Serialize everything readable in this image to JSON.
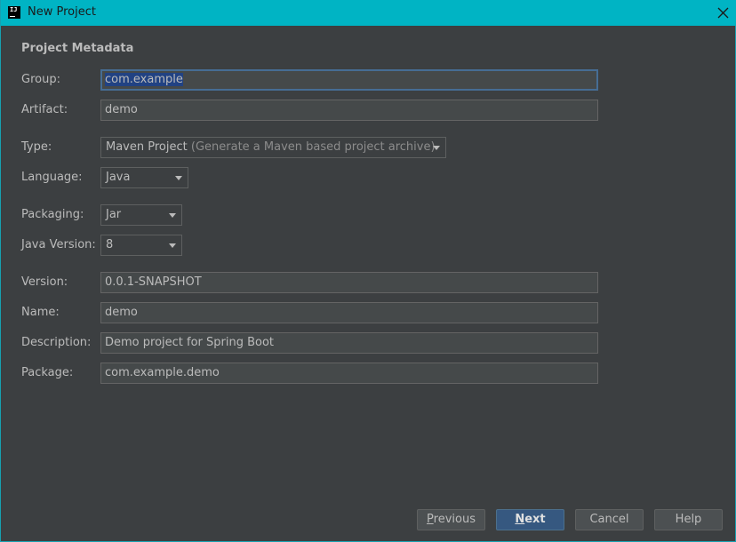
{
  "window": {
    "title": "New Project",
    "logo_text": "IJ",
    "icons": {
      "logo": "intellij-logo-icon",
      "close": "close-icon"
    }
  },
  "form": {
    "section_title": "Project Metadata",
    "group": {
      "label": "Group:",
      "value": "com.example"
    },
    "artifact": {
      "label": "Artifact:",
      "value": "demo"
    },
    "type": {
      "label": "Type:",
      "value": "Maven Project",
      "hint": "(Generate a Maven based project archive)"
    },
    "language": {
      "label": "Language:",
      "value": "Java"
    },
    "packaging": {
      "label": "Packaging:",
      "value": "Jar"
    },
    "java_version": {
      "label": "Java Version:",
      "value": "8"
    },
    "version": {
      "label": "Version:",
      "value": "0.0.1-SNAPSHOT"
    },
    "name": {
      "label": "Name:",
      "value": "demo"
    },
    "description": {
      "label": "Description:",
      "value": "Demo project for Spring Boot"
    },
    "package": {
      "label": "Package:",
      "value": "com.example.demo"
    }
  },
  "buttons": {
    "previous_mnemonic": "P",
    "previous_rest": "revious",
    "next_mnemonic": "N",
    "next_rest": "ext",
    "cancel": "Cancel",
    "help": "Help"
  },
  "colors": {
    "titlebar": "#00b4c4",
    "dialog_bg": "#3c3f41",
    "field_bg": "#45494a",
    "focus_border": "#466d94",
    "selection": "#214283",
    "default_button": "#365880"
  }
}
